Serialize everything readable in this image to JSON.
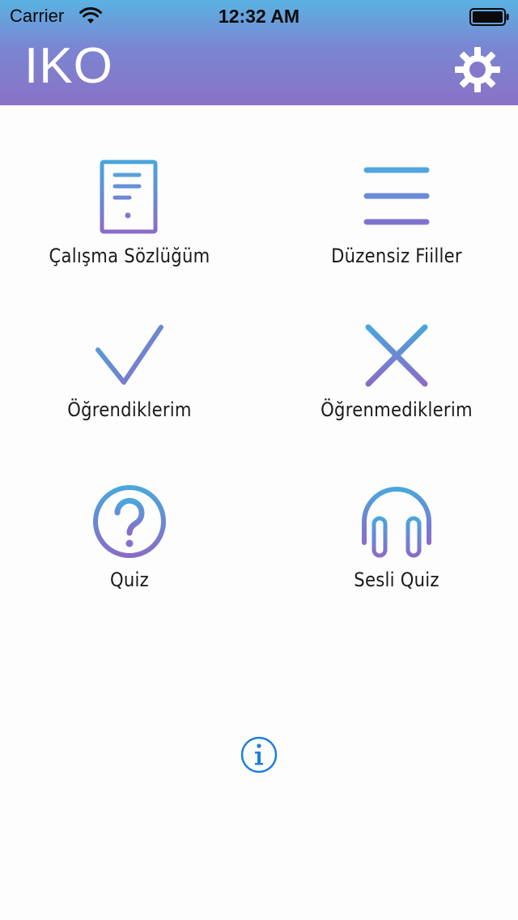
{
  "status_bar": {
    "carrier": "Carrier",
    "time": "12:32 AM"
  },
  "header": {
    "title": "IKO",
    "settings_icon": "gear-icon"
  },
  "menu": {
    "items": [
      {
        "label": "Çalışma Sözlüğüm",
        "icon": "document-icon"
      },
      {
        "label": "Düzensiz Fiiller",
        "icon": "list-icon"
      },
      {
        "label": "Öğrendiklerim",
        "icon": "checkmark-icon"
      },
      {
        "label": "Öğrenmediklerim",
        "icon": "cross-icon"
      },
      {
        "label": "Quiz",
        "icon": "question-icon"
      },
      {
        "label": "Sesli Quiz",
        "icon": "headphones-icon"
      }
    ]
  },
  "footer": {
    "info_icon": "info-icon"
  },
  "colors": {
    "gradient_top": "#5ab2e2",
    "gradient_bottom": "#8a72c6",
    "info_blue": "#1e7fe0"
  }
}
